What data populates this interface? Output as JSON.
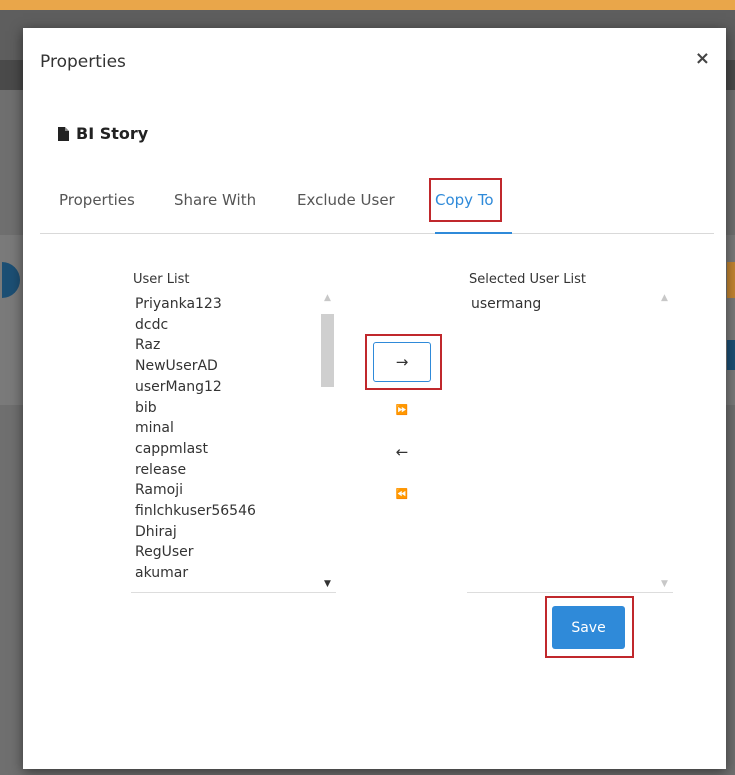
{
  "modal": {
    "title": "Properties",
    "close_label": "×"
  },
  "item": {
    "name": "BI Story",
    "icon": "document-icon"
  },
  "tabs": [
    {
      "label": "Properties",
      "active": false
    },
    {
      "label": "Share With",
      "active": false
    },
    {
      "label": "Exclude User",
      "active": false
    },
    {
      "label": "Copy To",
      "active": true
    }
  ],
  "user_list": {
    "label": "User List",
    "items": [
      "Priyanka123",
      "dcdc",
      "Raz",
      "NewUserAD",
      "userMang12",
      "bib",
      "minal",
      "cappmlast",
      "release",
      "Ramoji",
      "finlchkuser56546",
      "Dhiraj",
      "RegUser",
      "akumar"
    ]
  },
  "selected_user_list": {
    "label": "Selected User List",
    "items": [
      "usermang"
    ]
  },
  "move_buttons": {
    "move_right": "→",
    "move_all_right": "⏩",
    "move_left": "←",
    "move_all_left": "⏪"
  },
  "save_label": "Save",
  "colors": {
    "accent": "#2f8ad9",
    "highlight": "#c0282c"
  }
}
